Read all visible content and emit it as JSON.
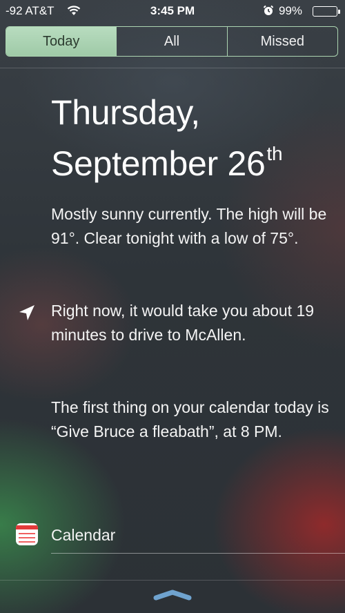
{
  "status_bar": {
    "carrier": "-92 AT&T",
    "wifi_icon": "wifi-icon",
    "time": "3:45 PM",
    "alarm_icon": "alarm-clock-icon",
    "battery_percent": "99%",
    "battery_level": 0.99
  },
  "tabs": [
    {
      "label": "Today",
      "active": true
    },
    {
      "label": "All",
      "active": false
    },
    {
      "label": "Missed",
      "active": false
    }
  ],
  "today": {
    "date_line1": "Thursday,",
    "date_line2": "September 26",
    "date_suffix": "th",
    "weather_summary": "Mostly sunny currently. The high will be 91°. Clear tonight with a low of 75°.",
    "drive_summary": "Right now, it would take you about 19 minutes to drive to McAllen.",
    "drive_icon": "location-arrow-icon",
    "calendar_summary": "The first thing on your calendar today is “Give Bruce a fleabath”, at 8 PM."
  },
  "calendar_section": {
    "icon": "calendar-icon",
    "label": "Calendar"
  },
  "colors": {
    "segment_active": "#b8dcbf",
    "segment_border": "#b9e6be"
  }
}
